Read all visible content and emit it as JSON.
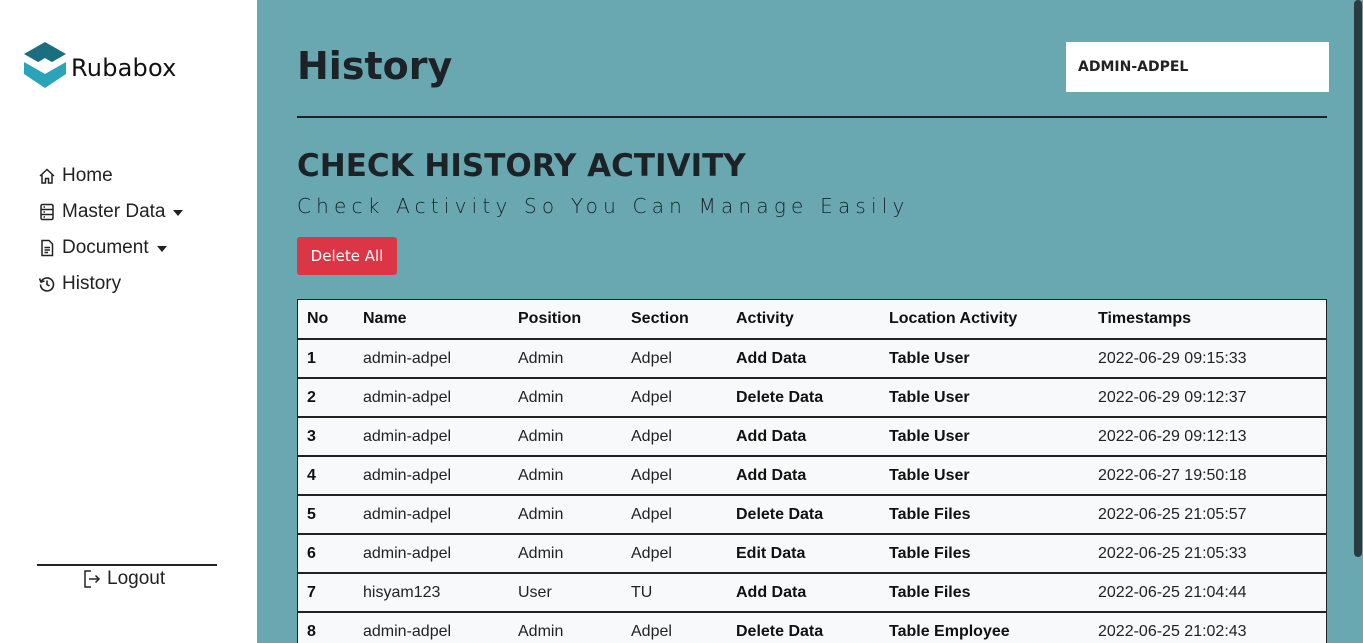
{
  "app": {
    "name": "Rubabox"
  },
  "sidebar": {
    "items": [
      {
        "label": "Home",
        "icon": "home-icon"
      },
      {
        "label": "Master Data",
        "icon": "database-icon",
        "dropdown": true
      },
      {
        "label": "Document",
        "icon": "document-icon",
        "dropdown": true
      },
      {
        "label": "History",
        "icon": "history-icon"
      }
    ],
    "logout_label": "Logout"
  },
  "header": {
    "title": "History",
    "user": "ADMIN-ADPEL"
  },
  "content": {
    "title": "CHECK HISTORY ACTIVITY",
    "subtitle": "Check Activity So You Can Manage Easily",
    "delete_all_label": "Delete All"
  },
  "table": {
    "headers": [
      "No",
      "Name",
      "Position",
      "Section",
      "Activity",
      "Location Activity",
      "Timestamps"
    ],
    "rows": [
      [
        "1",
        "admin-adpel",
        "Admin",
        "Adpel",
        "Add Data",
        "Table User",
        "2022-06-29 09:15:33"
      ],
      [
        "2",
        "admin-adpel",
        "Admin",
        "Adpel",
        "Delete Data",
        "Table User",
        "2022-06-29 09:12:37"
      ],
      [
        "3",
        "admin-adpel",
        "Admin",
        "Adpel",
        "Add Data",
        "Table User",
        "2022-06-29 09:12:13"
      ],
      [
        "4",
        "admin-adpel",
        "Admin",
        "Adpel",
        "Add Data",
        "Table User",
        "2022-06-27 19:50:18"
      ],
      [
        "5",
        "admin-adpel",
        "Admin",
        "Adpel",
        "Delete Data",
        "Table Files",
        "2022-06-25 21:05:57"
      ],
      [
        "6",
        "admin-adpel",
        "Admin",
        "Adpel",
        "Edit Data",
        "Table Files",
        "2022-06-25 21:05:33"
      ],
      [
        "7",
        "hisyam123",
        "User",
        "TU",
        "Add Data",
        "Table Files",
        "2022-06-25 21:04:44"
      ],
      [
        "8",
        "admin-adpel",
        "Admin",
        "Adpel",
        "Delete Data",
        "Table Employee",
        "2022-06-25 21:02:43"
      ]
    ]
  },
  "colors": {
    "background": "#69a8b1",
    "sidebar": "#ffffff",
    "danger": "#dc3545",
    "logo_dark": "#1a6e7e",
    "logo_light": "#2ba3b8"
  }
}
